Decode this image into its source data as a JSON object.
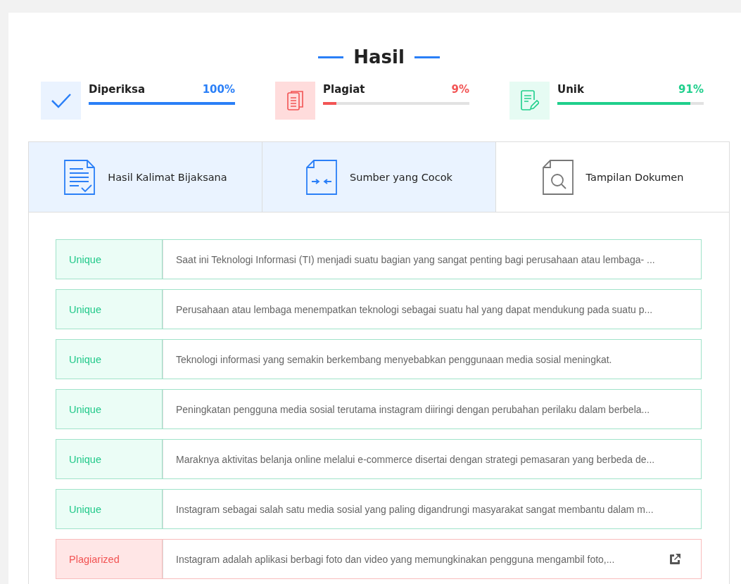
{
  "title": "Hasil",
  "stats": [
    {
      "kind": "checked",
      "label": "Diperiksa",
      "value": "100%",
      "level": 1.0
    },
    {
      "kind": "plagiarism",
      "label": "Plagiat",
      "value": "9%",
      "level": 0.09
    },
    {
      "kind": "unique",
      "label": "Unik",
      "value": "91%",
      "level": 0.91
    }
  ],
  "tabs": [
    {
      "kind": "sentences",
      "label": "Hasil Kalimat Bijaksana",
      "selected": true
    },
    {
      "kind": "sources",
      "label": "Sumber yang Cocok",
      "selected": true
    },
    {
      "kind": "document",
      "label": "Tampilan Dokumen",
      "selected": false
    }
  ],
  "rows": [
    {
      "kind": "unique",
      "status": "Unique",
      "text": "Saat ini Teknologi Informasi (TI) menjadi suatu bagian yang sangat penting bagi perusahaan atau lembaga- ...",
      "has_link": false
    },
    {
      "kind": "unique",
      "status": "Unique",
      "text": "Perusahaan atau lembaga menempatkan teknologi sebagai suatu hal yang dapat mendukung pada suatu p...",
      "has_link": false
    },
    {
      "kind": "unique",
      "status": "Unique",
      "text": "Teknologi informasi yang semakin berkembang menyebabkan penggunaan media sosial meningkat.",
      "has_link": false
    },
    {
      "kind": "unique",
      "status": "Unique",
      "text": "Peningkatan pengguna media sosial terutama instagram diiringi dengan perubahan perilaku dalam berbela...",
      "has_link": false
    },
    {
      "kind": "unique",
      "status": "Unique",
      "text": "Maraknya aktivitas belanja online melalui e-commerce disertai dengan strategi pemasaran yang berbeda de...",
      "has_link": false
    },
    {
      "kind": "unique",
      "status": "Unique",
      "text": "Instagram sebagai salah satu media sosial yang paling digandrungi masyarakat sangat membantu dalam m...",
      "has_link": false
    },
    {
      "kind": "plagiarized",
      "status": "Plagiarized",
      "text": "Instagram adalah aplikasi berbagi foto dan video yang memungkinakan pengguna mengambil foto,...",
      "has_link": true
    }
  ]
}
